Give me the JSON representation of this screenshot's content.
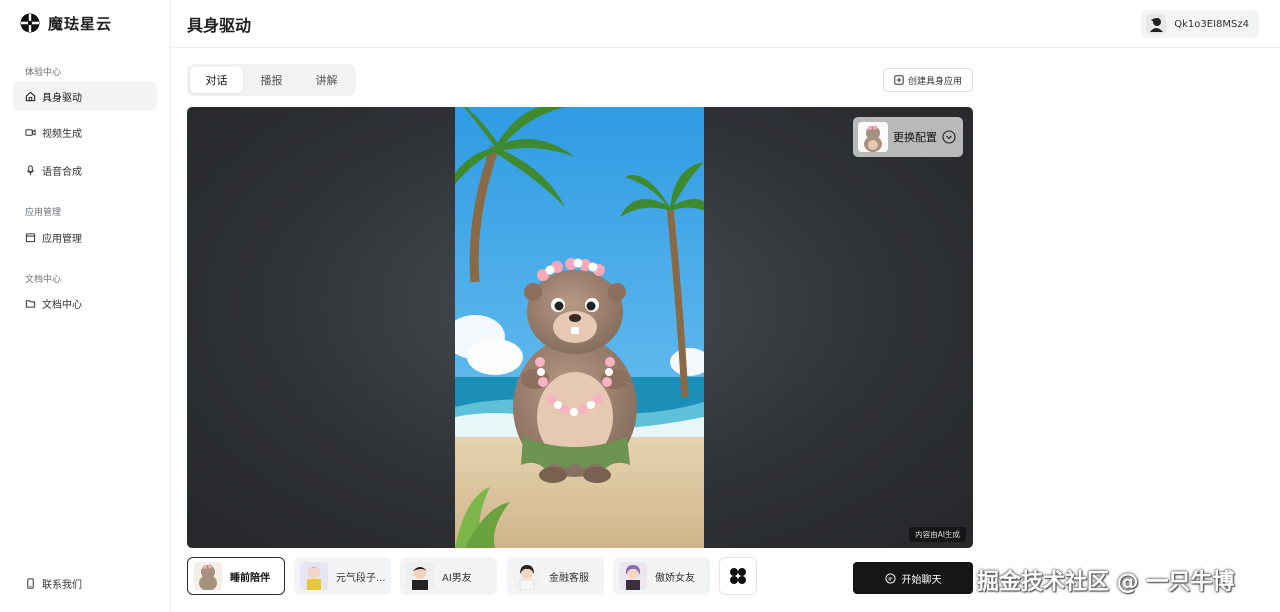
{
  "brand": {
    "name": "魔珐星云"
  },
  "sidebar": {
    "groups": [
      {
        "label": "体验中心",
        "items": [
          {
            "label": "具身驱动",
            "icon": "home-icon",
            "active": true
          },
          {
            "label": "视频生成",
            "icon": "video-icon"
          },
          {
            "label": "语音合成",
            "icon": "mic-icon"
          }
        ]
      },
      {
        "label": "应用管理",
        "items": [
          {
            "label": "应用管理",
            "icon": "box-icon"
          }
        ]
      },
      {
        "label": "文档中心",
        "items": [
          {
            "label": "文档中心",
            "icon": "folder-icon"
          }
        ]
      }
    ],
    "footer": {
      "label": "联系我们",
      "icon": "phone-icon"
    }
  },
  "header": {
    "title": "具身驱动",
    "user": "Qk1o3EI8MSz4"
  },
  "tabs": [
    {
      "label": "对话",
      "active": true
    },
    {
      "label": "播报"
    },
    {
      "label": "讲解"
    }
  ],
  "create_button": {
    "label": "创建具身应用"
  },
  "stage": {
    "config_button": "更换配置",
    "ai_badge": "内容由AI生成"
  },
  "characters": [
    {
      "label": "睡前陪伴",
      "active": true
    },
    {
      "label": "元气段子..."
    },
    {
      "label": "AI男友"
    },
    {
      "label": "金融客服"
    },
    {
      "label": "傲娇女友"
    }
  ],
  "chat_button": {
    "label": "开始聊天"
  },
  "watermark": "掘金技术社区 @ 一只牛博",
  "colors": {
    "primary": "#161616",
    "active_bg": "#f3f4f6",
    "sky": "#3aa7e6"
  }
}
